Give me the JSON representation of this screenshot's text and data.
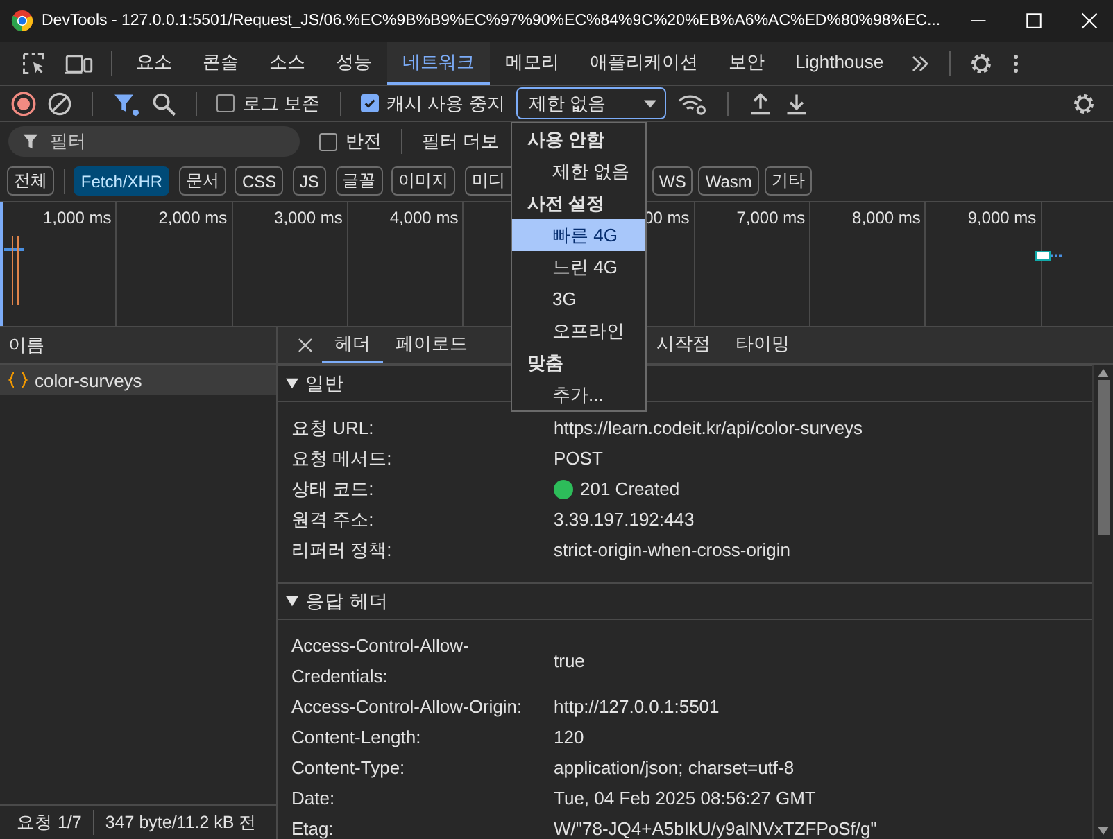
{
  "window": {
    "title": "DevTools - 127.0.0.1:5501/Request_JS/06.%EC%9B%B9%EC%97%90%EC%84%9C%20%EB%A6%AC%ED%80%98%EC..."
  },
  "panel_tabs": [
    {
      "label": "요소",
      "selected": false
    },
    {
      "label": "콘솔",
      "selected": false
    },
    {
      "label": "소스",
      "selected": false
    },
    {
      "label": "성능",
      "selected": false
    },
    {
      "label": "네트워크",
      "selected": true
    },
    {
      "label": "메모리",
      "selected": false
    },
    {
      "label": "애플리케이션",
      "selected": false
    },
    {
      "label": "보안",
      "selected": false
    },
    {
      "label": "Lighthouse",
      "selected": false
    }
  ],
  "toolbar": {
    "preserve_log": {
      "label": "로그 보존",
      "checked": false
    },
    "disable_cache": {
      "label": "캐시 사용 중지",
      "checked": true
    },
    "throttle": {
      "value": "제한 없음",
      "expanded": true
    }
  },
  "filter_bar": {
    "placeholder": "필터",
    "invert": {
      "label": "반전",
      "checked": false
    },
    "more_filters": "필터 더보"
  },
  "type_chips_before_menu": [
    {
      "label": "전체",
      "selected": false
    },
    {
      "label": "Fetch/XHR",
      "selected": true
    },
    {
      "label": "문서",
      "selected": false
    },
    {
      "label": "CSS",
      "selected": false
    },
    {
      "label": "JS",
      "selected": false
    },
    {
      "label": "글꼴",
      "selected": false
    },
    {
      "label": "이미지",
      "selected": false
    },
    {
      "label": "미디",
      "selected": false
    }
  ],
  "type_chips_after_menu": [
    {
      "label": "WS",
      "selected": false
    },
    {
      "label": "Wasm",
      "selected": false
    },
    {
      "label": "기타",
      "selected": false
    }
  ],
  "timeline": {
    "tick_labels_before_menu": [
      "1,000 ms",
      "2,000 ms",
      "3,000 ms",
      "4,000 ms"
    ],
    "tick_labels_after_menu": [
      "00 ms",
      "7,000 ms",
      "8,000 ms",
      "9,000 ms"
    ]
  },
  "requests": {
    "column": "이름",
    "rows": [
      {
        "name": "color-surveys",
        "selected": true
      }
    ]
  },
  "detail_tabs_before_menu": [
    {
      "label": "헤더",
      "selected": true
    },
    {
      "label": "페이로드",
      "selected": false
    }
  ],
  "detail_tabs_after_menu": [
    {
      "label": "시작점",
      "selected": false
    },
    {
      "label": "타이밍",
      "selected": false
    }
  ],
  "sections": [
    {
      "title": "일반",
      "expanded": true,
      "rows": [
        {
          "key": "요청 URL:",
          "value": "https://learn.codeit.kr/api/color-surveys"
        },
        {
          "key": "요청 메서드:",
          "value": "POST"
        },
        {
          "key": "상태 코드:",
          "value": "201 Created",
          "color": "#2dbd5a"
        },
        {
          "key": "원격 주소:",
          "value": "3.39.197.192:443"
        },
        {
          "key": "리퍼러 정책:",
          "value": "strict-origin-when-cross-origin"
        }
      ]
    },
    {
      "title": "응답 헤더",
      "expanded": true,
      "rows": [
        {
          "key": "Access-Control-Allow-Credentials:",
          "value": "true"
        },
        {
          "key": "Access-Control-Allow-Origin:",
          "value": "http://127.0.0.1:5501"
        },
        {
          "key": "Content-Length:",
          "value": "120"
        },
        {
          "key": "Content-Type:",
          "value": "application/json; charset=utf-8"
        },
        {
          "key": "Date:",
          "value": "Tue, 04 Feb 2025 08:56:27 GMT"
        },
        {
          "key": "Etag:",
          "value": "W/\"78-JQ4+A5bIkU/y9alNVxTZFPoSf/g\""
        }
      ]
    }
  ],
  "status_bar": {
    "requests": "요청 1/7",
    "transfer": "347 byte/11.2 kB 전"
  },
  "throttle_menu": {
    "groups": [
      {
        "title": "사용 안함",
        "items": [
          {
            "label": "제한 없음",
            "selected": false
          }
        ]
      },
      {
        "title": "사전 설정",
        "items": [
          {
            "label": "빠른 4G",
            "selected": true
          },
          {
            "label": "느린 4G",
            "selected": false
          },
          {
            "label": "3G",
            "selected": false
          },
          {
            "label": "오프라인",
            "selected": false
          }
        ]
      },
      {
        "title": "맞춤",
        "items": [
          {
            "label": "추가...",
            "selected": false
          }
        ]
      }
    ]
  }
}
